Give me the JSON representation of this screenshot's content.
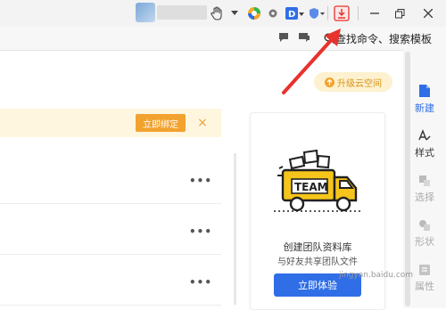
{
  "toolbar": {
    "icons": [
      "avatar",
      "hand-icon",
      "chevron-down-icon",
      "browser-icon",
      "settings-icon",
      "d-app-icon",
      "shield-icon",
      "download-icon",
      "minimize-icon",
      "restore-icon",
      "close-icon"
    ]
  },
  "commandbar": {
    "search_text": "查找命令、搜索模板"
  },
  "upgrade": {
    "label": "升级云空间"
  },
  "bind_banner": {
    "button": "立即绑定",
    "close": "×"
  },
  "list": {
    "more": "•••"
  },
  "team_card": {
    "title": "创建团队资料库",
    "subtitle": "与好友共享团队文件",
    "button": "立即体验",
    "truck_text": "TEAM"
  },
  "right_panel": {
    "items": [
      {
        "label": "新建",
        "icon": "file-icon",
        "active": true
      },
      {
        "label": "样式",
        "icon": "style-icon",
        "active": true
      },
      {
        "label": "选择",
        "icon": "select-icon",
        "active": false
      },
      {
        "label": "形状",
        "icon": "shape-icon",
        "active": false
      },
      {
        "label": "属性",
        "icon": "property-icon",
        "active": false
      }
    ]
  },
  "watermark": "jingyan.baidu.com",
  "colors": {
    "accent_blue": "#2f6ee6",
    "accent_orange": "#f2a22e",
    "annotation_red": "#e8322d"
  }
}
